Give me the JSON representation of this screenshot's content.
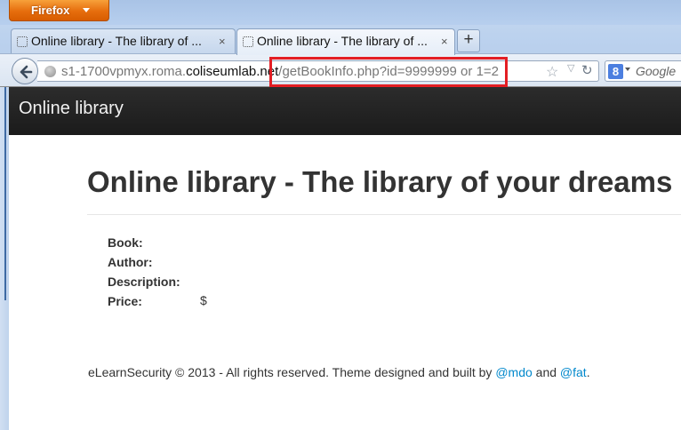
{
  "browser": {
    "menu_button": "Firefox",
    "tabs": [
      {
        "title": "Online library - The library of ...",
        "close": "×"
      },
      {
        "title": "Online library - The library of ...",
        "close": "×"
      }
    ],
    "new_tab": "+",
    "url_prefix": "s1-1700vpmyx.roma.",
    "url_domain": "coliseumlab.net",
    "url_path": "/getBookInfo.php?id=9999999 or 1=2",
    "search_engine_badge": "8",
    "search_placeholder": "Google",
    "highlight_color": "#e31e24"
  },
  "site": {
    "brand": "Online library",
    "heading": "Online library - The library of your dreams",
    "fields": {
      "book": "Book:",
      "author": "Author:",
      "description": "Description:",
      "price": "Price:"
    },
    "price_value": "$",
    "footer": {
      "text": "eLearnSecurity © 2013 - All rights reserved. Theme designed and built by",
      "link1": "@mdo",
      "and": "and",
      "link2": "@fat",
      "end": "."
    }
  },
  "colors": {
    "navbar_bg": "#1b1b1b",
    "link": "#0088cc",
    "firefox_orange": "#e66d0d"
  }
}
